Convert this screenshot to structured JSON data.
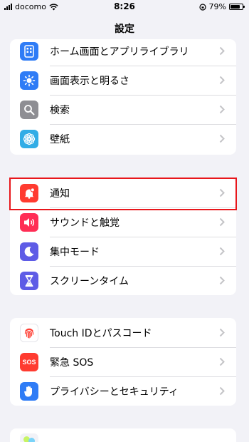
{
  "status_bar": {
    "carrier": "docomo",
    "time": "8:26",
    "battery": "79%"
  },
  "nav": {
    "title": "設定"
  },
  "groups": [
    {
      "rows": [
        {
          "label": "ホーム画面とアプリライブラリ",
          "icon": "home-screen-icon",
          "color": "#2f7cf6"
        },
        {
          "label": "画面表示と明るさ",
          "icon": "brightness-icon",
          "color": "#2f7cf6"
        },
        {
          "label": "検索",
          "icon": "search-icon",
          "color": "#8e8e93"
        },
        {
          "label": "壁紙",
          "icon": "wallpaper-icon",
          "color": "#32ade6"
        }
      ]
    },
    {
      "rows": [
        {
          "label": "通知",
          "icon": "notification-icon",
          "color": "#ff3b30"
        },
        {
          "label": "サウンドと触覚",
          "icon": "sound-icon",
          "color": "#ff2d55"
        },
        {
          "label": "集中モード",
          "icon": "focus-moon-icon",
          "color": "#5e5ce6"
        },
        {
          "label": "スクリーンタイム",
          "icon": "hourglass-icon",
          "color": "#5e5ce6"
        }
      ]
    },
    {
      "rows": [
        {
          "label": "Touch IDとパスコード",
          "icon": "fingerprint-icon",
          "color": "#ff3b30"
        },
        {
          "label": "緊急 SOS",
          "icon": "sos-icon",
          "color": "#ff3b30",
          "icon_text": "SOS"
        },
        {
          "label": "プライバシーとセキュリティ",
          "icon": "privacy-hand-icon",
          "color": "#2f7cf6"
        }
      ]
    }
  ],
  "highlight_color": "#e8161b"
}
